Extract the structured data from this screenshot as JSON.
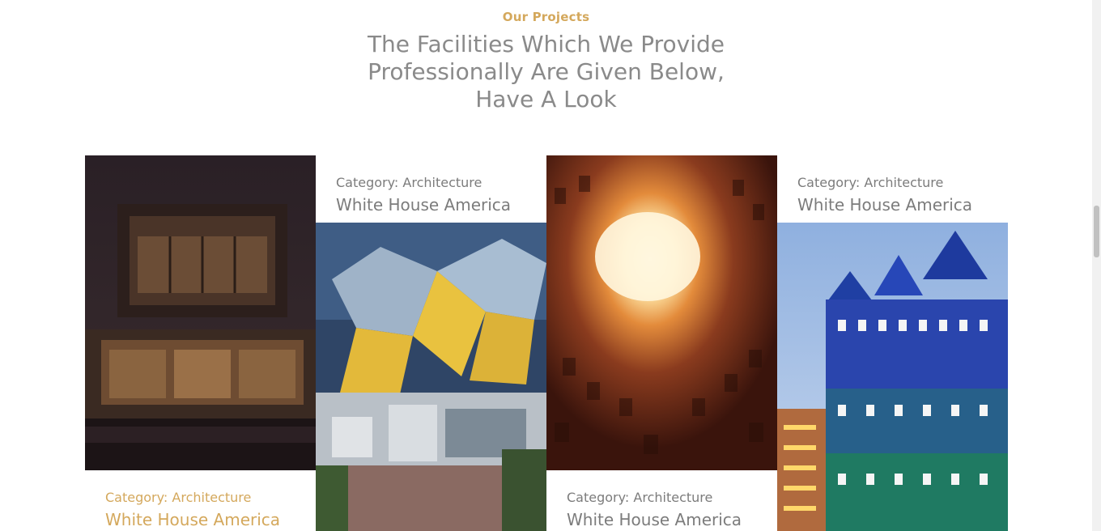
{
  "section": {
    "eyebrow": "Our Projects",
    "headline_line1": "The Facilities Which We Provide",
    "headline_line2": "Professionally Are Given Below,",
    "headline_line3": "Have A Look"
  },
  "projects": [
    {
      "category": "Category: Architecture",
      "title": "White House America",
      "image": "modern-house-night"
    },
    {
      "category": "Category: Architecture",
      "title": "White House America",
      "image": "cube-houses"
    },
    {
      "category": "Category: Architecture",
      "title": "White House America",
      "image": "courtyard-looking-up"
    },
    {
      "category": "Category: Architecture",
      "title": "White House America",
      "image": "stacked-green-houses"
    }
  ],
  "colors": {
    "accent": "#d4a85c",
    "text_gray": "#7c7c7c",
    "heading_gray": "#8a8a8a"
  }
}
